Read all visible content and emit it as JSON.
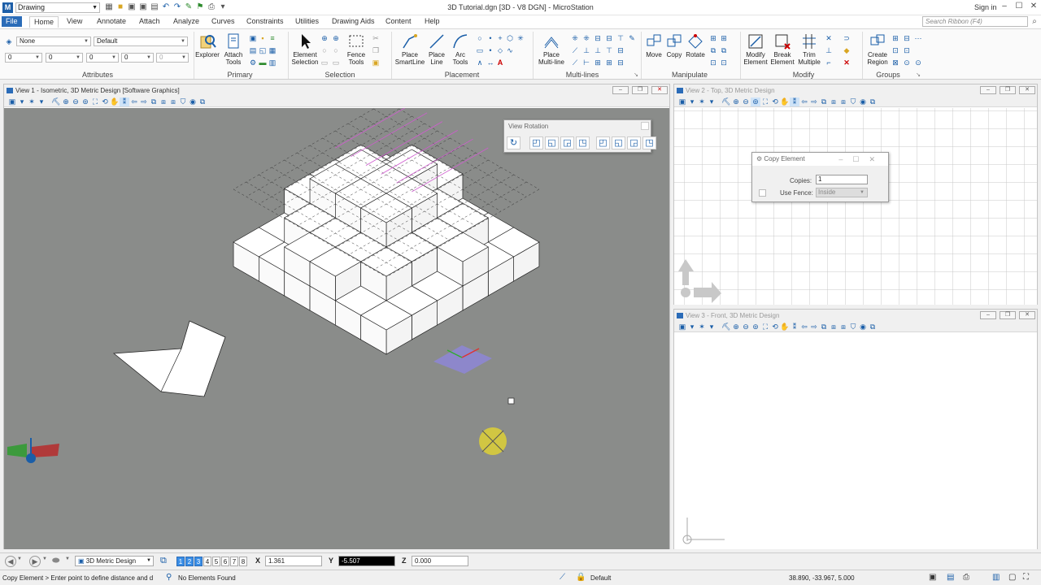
{
  "app": {
    "window_title": "3D Tutorial.dgn [3D - V8 DGN] - MicroStation",
    "workflow": "Drawing",
    "sign_in": "Sign in"
  },
  "ribbon": {
    "tabs": [
      "File",
      "Home",
      "View",
      "Annotate",
      "Attach",
      "Analyze",
      "Curves",
      "Constraints",
      "Utilities",
      "Drawing Aids",
      "Content",
      "Help"
    ],
    "active_tab": "Home",
    "search_placeholder": "Search Ribbon (F4)",
    "attributes": {
      "level": "None",
      "style": "Default",
      "color": "0",
      "weight": "0",
      "line_style": "0",
      "transparency": "0",
      "priority": "0",
      "group_label": "Attributes"
    },
    "primary": {
      "explorer": "Explorer",
      "attach_tools_1": "Attach",
      "attach_tools_2": "Tools",
      "group_label": "Primary"
    },
    "selection": {
      "element_selection_1": "Element",
      "element_selection_2": "Selection",
      "fence_tools_1": "Fence",
      "fence_tools_2": "Tools",
      "group_label": "Selection"
    },
    "placement": {
      "smartline_1": "Place",
      "smartline_2": "SmartLine",
      "line_1": "Place",
      "line_2": "Line",
      "arc_1": "Arc",
      "arc_2": "Tools",
      "group_label": "Placement"
    },
    "multilines": {
      "place_1": "Place",
      "place_2": "Multi-line",
      "group_label": "Multi-lines"
    },
    "manipulate": {
      "move": "Move",
      "copy": "Copy",
      "rotate": "Rotate",
      "group_label": "Manipulate"
    },
    "modify": {
      "modify_1": "Modify",
      "modify_2": "Element",
      "break_1": "Break",
      "break_2": "Element",
      "trim_1": "Trim",
      "trim_2": "Multiple",
      "group_label": "Modify"
    },
    "groups": {
      "create_1": "Create",
      "create_2": "Region",
      "group_label": "Groups"
    }
  },
  "views": {
    "view1_title": "View 1 - Isometric, 3D Metric Design [Software Graphics]",
    "view2_title": "View 2 - Top, 3D Metric Design",
    "view3_title": "View 3 - Front, 3D Metric Design",
    "view1_bg": "#8a8c8a",
    "grid_color": "#c8c8c8"
  },
  "view_rotation": {
    "title": "View Rotation"
  },
  "copy_element": {
    "title": "Copy Element",
    "copies_label": "Copies:",
    "copies_value": "1",
    "use_fence_label": "Use Fence:",
    "use_fence_value": "Inside",
    "use_fence_checked": false
  },
  "bottom_toolbar": {
    "model": "3D Metric Design",
    "view_numbers": [
      "1",
      "2",
      "3",
      "4",
      "5",
      "6",
      "7",
      "8"
    ],
    "active_views": [
      "1",
      "2",
      "3"
    ],
    "x_label": "X",
    "x_value": "1.361",
    "y_label": "Y",
    "y_value": "-5.507",
    "z_label": "Z",
    "z_value": "0.000"
  },
  "status": {
    "prompt": "Copy Element > Enter point to define distance and d",
    "selection": "No Elements Found",
    "level": "Default",
    "coordinates": "38.890, -33.967, 5.000"
  }
}
